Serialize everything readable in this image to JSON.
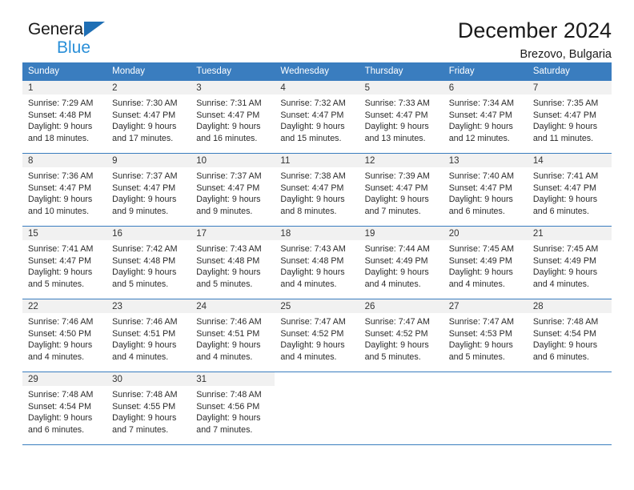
{
  "brand": {
    "line1": "General",
    "line2": "Blue",
    "triangle_color": "#1f6fb5",
    "blue_text_color": "#2a8fd8"
  },
  "header": {
    "title": "December 2024",
    "subtitle": "Brezovo, Bulgaria"
  },
  "theme": {
    "header_bg": "#3a7dbf",
    "daynum_bg": "#f1f1f1",
    "text": "#222222"
  },
  "weekdays": [
    "Sunday",
    "Monday",
    "Tuesday",
    "Wednesday",
    "Thursday",
    "Friday",
    "Saturday"
  ],
  "weeks": [
    [
      {
        "day": "1",
        "sunrise": "Sunrise: 7:29 AM",
        "sunset": "Sunset: 4:48 PM",
        "daylight1": "Daylight: 9 hours",
        "daylight2": "and 18 minutes."
      },
      {
        "day": "2",
        "sunrise": "Sunrise: 7:30 AM",
        "sunset": "Sunset: 4:47 PM",
        "daylight1": "Daylight: 9 hours",
        "daylight2": "and 17 minutes."
      },
      {
        "day": "3",
        "sunrise": "Sunrise: 7:31 AM",
        "sunset": "Sunset: 4:47 PM",
        "daylight1": "Daylight: 9 hours",
        "daylight2": "and 16 minutes."
      },
      {
        "day": "4",
        "sunrise": "Sunrise: 7:32 AM",
        "sunset": "Sunset: 4:47 PM",
        "daylight1": "Daylight: 9 hours",
        "daylight2": "and 15 minutes."
      },
      {
        "day": "5",
        "sunrise": "Sunrise: 7:33 AM",
        "sunset": "Sunset: 4:47 PM",
        "daylight1": "Daylight: 9 hours",
        "daylight2": "and 13 minutes."
      },
      {
        "day": "6",
        "sunrise": "Sunrise: 7:34 AM",
        "sunset": "Sunset: 4:47 PM",
        "daylight1": "Daylight: 9 hours",
        "daylight2": "and 12 minutes."
      },
      {
        "day": "7",
        "sunrise": "Sunrise: 7:35 AM",
        "sunset": "Sunset: 4:47 PM",
        "daylight1": "Daylight: 9 hours",
        "daylight2": "and 11 minutes."
      }
    ],
    [
      {
        "day": "8",
        "sunrise": "Sunrise: 7:36 AM",
        "sunset": "Sunset: 4:47 PM",
        "daylight1": "Daylight: 9 hours",
        "daylight2": "and 10 minutes."
      },
      {
        "day": "9",
        "sunrise": "Sunrise: 7:37 AM",
        "sunset": "Sunset: 4:47 PM",
        "daylight1": "Daylight: 9 hours",
        "daylight2": "and 9 minutes."
      },
      {
        "day": "10",
        "sunrise": "Sunrise: 7:37 AM",
        "sunset": "Sunset: 4:47 PM",
        "daylight1": "Daylight: 9 hours",
        "daylight2": "and 9 minutes."
      },
      {
        "day": "11",
        "sunrise": "Sunrise: 7:38 AM",
        "sunset": "Sunset: 4:47 PM",
        "daylight1": "Daylight: 9 hours",
        "daylight2": "and 8 minutes."
      },
      {
        "day": "12",
        "sunrise": "Sunrise: 7:39 AM",
        "sunset": "Sunset: 4:47 PM",
        "daylight1": "Daylight: 9 hours",
        "daylight2": "and 7 minutes."
      },
      {
        "day": "13",
        "sunrise": "Sunrise: 7:40 AM",
        "sunset": "Sunset: 4:47 PM",
        "daylight1": "Daylight: 9 hours",
        "daylight2": "and 6 minutes."
      },
      {
        "day": "14",
        "sunrise": "Sunrise: 7:41 AM",
        "sunset": "Sunset: 4:47 PM",
        "daylight1": "Daylight: 9 hours",
        "daylight2": "and 6 minutes."
      }
    ],
    [
      {
        "day": "15",
        "sunrise": "Sunrise: 7:41 AM",
        "sunset": "Sunset: 4:47 PM",
        "daylight1": "Daylight: 9 hours",
        "daylight2": "and 5 minutes."
      },
      {
        "day": "16",
        "sunrise": "Sunrise: 7:42 AM",
        "sunset": "Sunset: 4:48 PM",
        "daylight1": "Daylight: 9 hours",
        "daylight2": "and 5 minutes."
      },
      {
        "day": "17",
        "sunrise": "Sunrise: 7:43 AM",
        "sunset": "Sunset: 4:48 PM",
        "daylight1": "Daylight: 9 hours",
        "daylight2": "and 5 minutes."
      },
      {
        "day": "18",
        "sunrise": "Sunrise: 7:43 AM",
        "sunset": "Sunset: 4:48 PM",
        "daylight1": "Daylight: 9 hours",
        "daylight2": "and 4 minutes."
      },
      {
        "day": "19",
        "sunrise": "Sunrise: 7:44 AM",
        "sunset": "Sunset: 4:49 PM",
        "daylight1": "Daylight: 9 hours",
        "daylight2": "and 4 minutes."
      },
      {
        "day": "20",
        "sunrise": "Sunrise: 7:45 AM",
        "sunset": "Sunset: 4:49 PM",
        "daylight1": "Daylight: 9 hours",
        "daylight2": "and 4 minutes."
      },
      {
        "day": "21",
        "sunrise": "Sunrise: 7:45 AM",
        "sunset": "Sunset: 4:49 PM",
        "daylight1": "Daylight: 9 hours",
        "daylight2": "and 4 minutes."
      }
    ],
    [
      {
        "day": "22",
        "sunrise": "Sunrise: 7:46 AM",
        "sunset": "Sunset: 4:50 PM",
        "daylight1": "Daylight: 9 hours",
        "daylight2": "and 4 minutes."
      },
      {
        "day": "23",
        "sunrise": "Sunrise: 7:46 AM",
        "sunset": "Sunset: 4:51 PM",
        "daylight1": "Daylight: 9 hours",
        "daylight2": "and 4 minutes."
      },
      {
        "day": "24",
        "sunrise": "Sunrise: 7:46 AM",
        "sunset": "Sunset: 4:51 PM",
        "daylight1": "Daylight: 9 hours",
        "daylight2": "and 4 minutes."
      },
      {
        "day": "25",
        "sunrise": "Sunrise: 7:47 AM",
        "sunset": "Sunset: 4:52 PM",
        "daylight1": "Daylight: 9 hours",
        "daylight2": "and 4 minutes."
      },
      {
        "day": "26",
        "sunrise": "Sunrise: 7:47 AM",
        "sunset": "Sunset: 4:52 PM",
        "daylight1": "Daylight: 9 hours",
        "daylight2": "and 5 minutes."
      },
      {
        "day": "27",
        "sunrise": "Sunrise: 7:47 AM",
        "sunset": "Sunset: 4:53 PM",
        "daylight1": "Daylight: 9 hours",
        "daylight2": "and 5 minutes."
      },
      {
        "day": "28",
        "sunrise": "Sunrise: 7:48 AM",
        "sunset": "Sunset: 4:54 PM",
        "daylight1": "Daylight: 9 hours",
        "daylight2": "and 6 minutes."
      }
    ],
    [
      {
        "day": "29",
        "sunrise": "Sunrise: 7:48 AM",
        "sunset": "Sunset: 4:54 PM",
        "daylight1": "Daylight: 9 hours",
        "daylight2": "and 6 minutes."
      },
      {
        "day": "30",
        "sunrise": "Sunrise: 7:48 AM",
        "sunset": "Sunset: 4:55 PM",
        "daylight1": "Daylight: 9 hours",
        "daylight2": "and 7 minutes."
      },
      {
        "day": "31",
        "sunrise": "Sunrise: 7:48 AM",
        "sunset": "Sunset: 4:56 PM",
        "daylight1": "Daylight: 9 hours",
        "daylight2": "and 7 minutes."
      },
      {
        "day": "",
        "sunrise": "",
        "sunset": "",
        "daylight1": "",
        "daylight2": ""
      },
      {
        "day": "",
        "sunrise": "",
        "sunset": "",
        "daylight1": "",
        "daylight2": ""
      },
      {
        "day": "",
        "sunrise": "",
        "sunset": "",
        "daylight1": "",
        "daylight2": ""
      },
      {
        "day": "",
        "sunrise": "",
        "sunset": "",
        "daylight1": "",
        "daylight2": ""
      }
    ]
  ]
}
